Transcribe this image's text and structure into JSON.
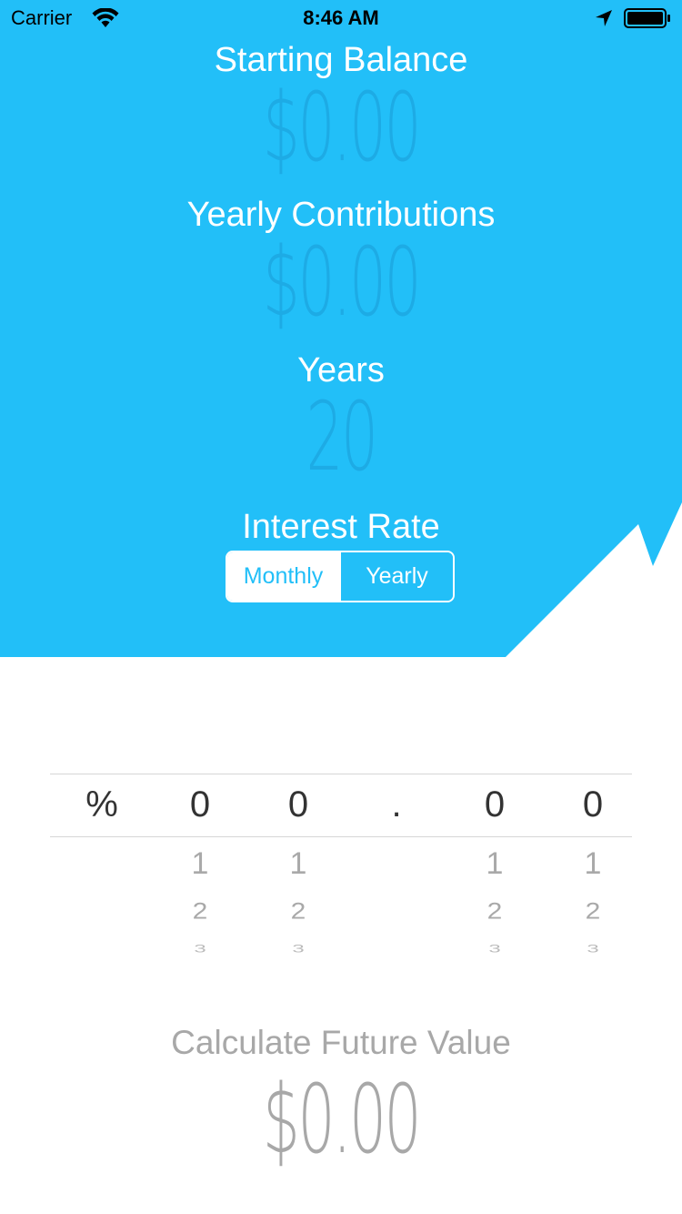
{
  "status_bar": {
    "carrier": "Carrier",
    "time": "8:46 AM"
  },
  "fields": {
    "starting_balance": {
      "label": "Starting Balance",
      "value": "$0.00"
    },
    "yearly_contributions": {
      "label": "Yearly Contributions",
      "value": "$0.00"
    },
    "years": {
      "label": "Years",
      "value": "20"
    }
  },
  "interest": {
    "label": "Interest Rate",
    "options": [
      "Monthly",
      "Yearly"
    ],
    "selected": "Monthly"
  },
  "picker": {
    "columns": [
      {
        "selected": "%",
        "below": []
      },
      {
        "selected": "0",
        "below": [
          "1",
          "2",
          "3"
        ]
      },
      {
        "selected": "0",
        "below": [
          "1",
          "2",
          "3"
        ]
      },
      {
        "selected": ".",
        "below": []
      },
      {
        "selected": "0",
        "below": [
          "1",
          "2",
          "3"
        ]
      },
      {
        "selected": "0",
        "below": [
          "1",
          "2",
          "3"
        ]
      }
    ]
  },
  "result": {
    "button_label": "Calculate Future Value",
    "value": "$0.00"
  },
  "colors": {
    "accent": "#22bff8",
    "value_text": "#1a9bd6",
    "muted_text": "#a8a8a8"
  }
}
